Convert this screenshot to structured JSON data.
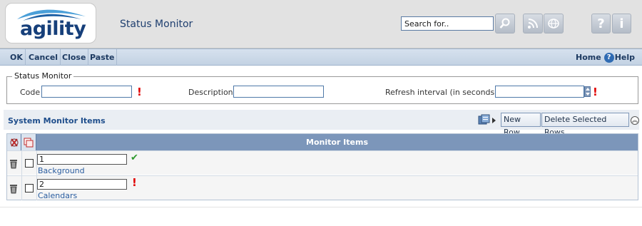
{
  "header": {
    "logo_text": "agility",
    "page_title": "Status Monitor",
    "search": {
      "value": "Search for.."
    },
    "icons": [
      "search-icon",
      "rss-icon",
      "globe-icon",
      "help-icon",
      "info-icon"
    ],
    "help_glyph": "?",
    "info_glyph": "i"
  },
  "toolbar": {
    "ok": "OK",
    "cancel": "Cancel",
    "close": "Close",
    "paste": "Paste",
    "home": "Home",
    "help": "Help"
  },
  "status_monitor": {
    "legend": "Status Monitor",
    "code_label": "Code",
    "description_label": "Description",
    "refresh_label": "Refresh interval (in seconds)",
    "code_value": "",
    "description_value": "",
    "refresh_value": ""
  },
  "monitor_items": {
    "title": "System Monitor Items",
    "new_row": "New Row",
    "delete_rows": "Delete Selected Rows",
    "column_header": "Monitor Items",
    "rows": [
      {
        "value": "1",
        "link": "Background",
        "status": "valid"
      },
      {
        "value": "2",
        "link": "Calendars",
        "status": "required"
      }
    ]
  },
  "colors": {
    "brand_blue": "#163f7a",
    "toolbar_bg": "#c3d2e3",
    "grid_header": "#7c96ba",
    "required_red": "#e00000",
    "valid_green": "#2e9a2e"
  }
}
